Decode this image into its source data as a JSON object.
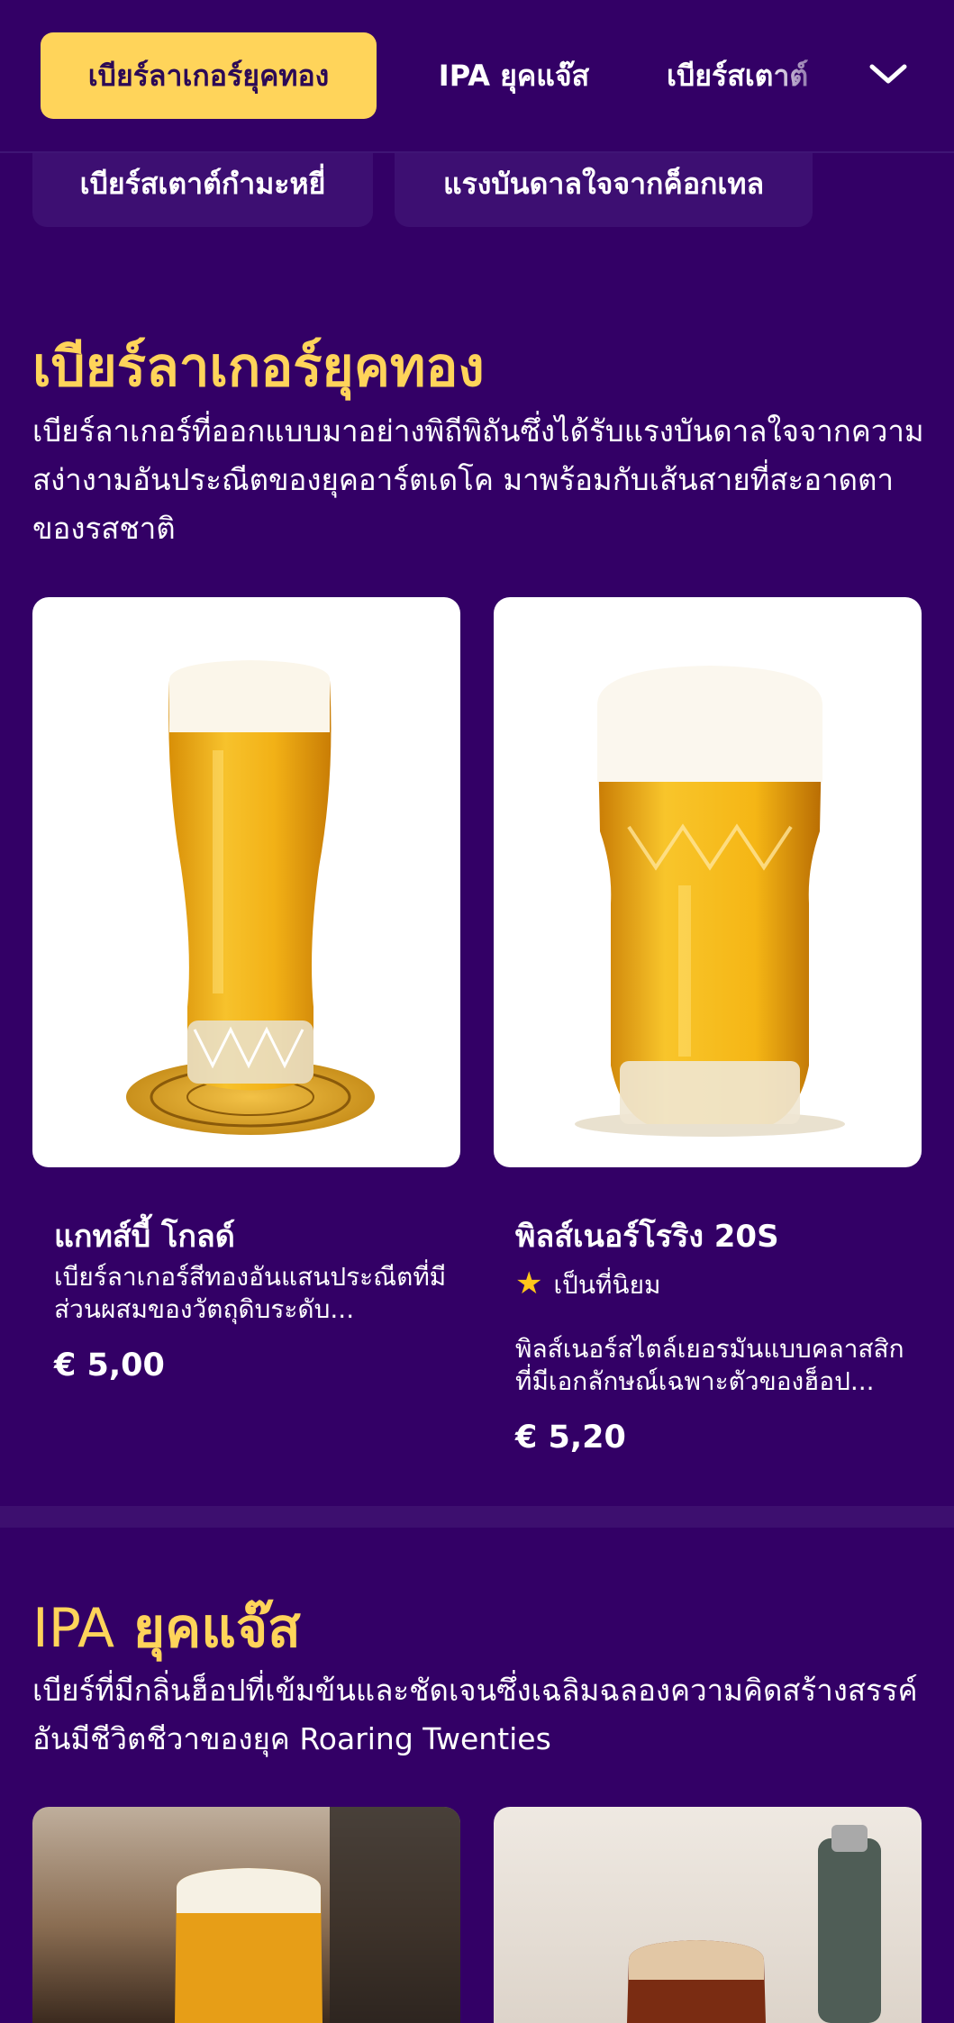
{
  "nav": {
    "tabs": [
      {
        "label": "เบียร์ลาเกอร์ยุคทอง"
      },
      {
        "label": "IPA ยุคแจ๊ส"
      },
      {
        "label": "เบียร์สเตาต์"
      }
    ],
    "subtabs": [
      {
        "label": "เบียร์สเตาต์กำมะหยี่"
      },
      {
        "label": "แรงบันดาลใจจากค็อกเทล"
      }
    ],
    "expand_icon": "chevron-down-icon"
  },
  "sections": [
    {
      "title": "เบียร์ลาเกอร์ยุคทอง",
      "description": "เบียร์ลาเกอร์ที่ออกแบบมาอย่างพิถีพิถันซึ่งได้รับแรงบันดาลใจจากความสง่างามอันประณีตของยุคอาร์ตเดโค มาพร้อมกับเส้นสายที่สะอาดตาของรสชาติ",
      "products": [
        {
          "name": "แกทส์บี้ โกลด์",
          "description": "เบียร์ลาเกอร์สีทองอันแสนประณีตที่มีส่วนผสมของวัตถุดิบระดับ...",
          "price": "€ 5,00"
        },
        {
          "name": "พิลส์เนอร์โรริง 20S",
          "badge": "เป็นที่นิยม",
          "description": "พิลส์เนอร์สไตล์เยอรมันแบบคลาสสิกที่มีเอกลักษณ์เฉพาะตัวของฮ็อป...",
          "price": "€ 5,20"
        }
      ]
    },
    {
      "title_prefix": "IPA",
      "title_rest": "ยุคแจ๊ส",
      "description": "เบียร์ที่มีกลิ่นฮ็อปที่เข้มข้นและชัดเจนซึ่งเฉลิมฉลองความคิดสร้างสรรค์อันมีชีวิตชีวาของยุค Roaring Twenties"
    }
  ],
  "colors": {
    "background": "#330066",
    "accent": "#ffd45a",
    "star": "#ffc61a"
  }
}
